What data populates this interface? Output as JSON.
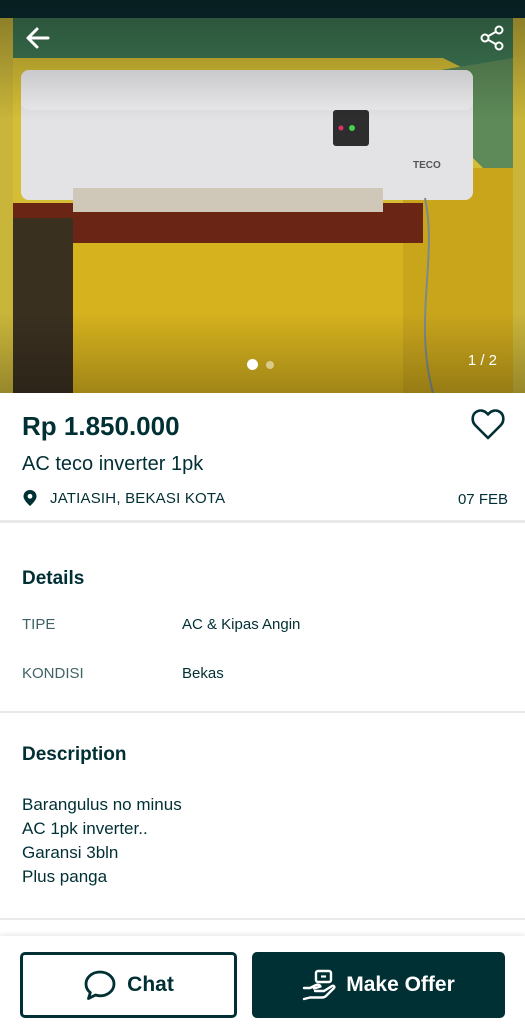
{
  "photo": {
    "brand_text": "TECO",
    "counter": "1 / 2",
    "current_index": 1,
    "total": 2
  },
  "icons": {
    "back": "back-arrow-icon",
    "share": "share-icon",
    "favorite": "heart-icon",
    "location": "location-pin-icon",
    "chat": "chat-bubble-icon",
    "offer": "offer-hand-icon"
  },
  "listing": {
    "price": "Rp 1.850.000",
    "title": "AC teco inverter 1pk",
    "location": "JATIASIH, BEKASI KOTA",
    "date": "07 FEB"
  },
  "details": {
    "title": "Details",
    "rows": [
      {
        "key": "TIPE",
        "value": "AC & Kipas Angin"
      },
      {
        "key": "KONDISI",
        "value": "Bekas"
      }
    ]
  },
  "description": {
    "title": "Description",
    "text": "Barangulus no minus\nAC 1pk inverter..\nGaransi 3bln\nPlus panga"
  },
  "actions": {
    "chat_label": "Chat",
    "offer_label": "Make Offer"
  },
  "colors": {
    "primary": "#002f34",
    "muted": "#406367",
    "divider": "#e8eaeb"
  }
}
